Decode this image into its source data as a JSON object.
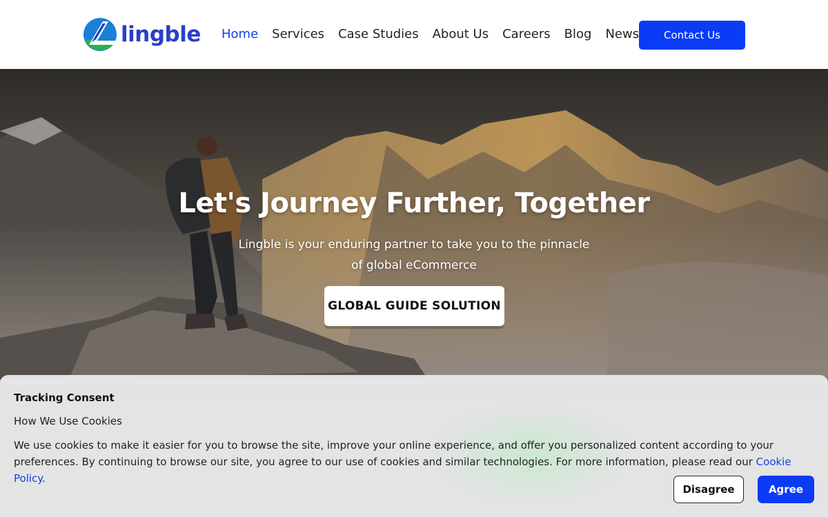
{
  "brand": {
    "name": "lingble",
    "logo_icon": "lingble-logo-icon"
  },
  "nav": {
    "items": [
      {
        "label": "Home",
        "active": true
      },
      {
        "label": "Services"
      },
      {
        "label": "Case Studies"
      },
      {
        "label": "About Us"
      },
      {
        "label": "Careers"
      },
      {
        "label": "Blog"
      },
      {
        "label": "News"
      }
    ],
    "contact_label": "Contact Us"
  },
  "hero": {
    "title": "Let's Journey Further, Together",
    "subtitle": "Lingble is your enduring partner to take you to the pinnacle of global eCommerce",
    "cta_label": "GLOBAL GUIDE SOLUTION"
  },
  "cookie": {
    "title": "Tracking Consent",
    "subtitle": "How We Use Cookies",
    "text": "We use cookies to make it easier for you to browse the site, improve your online experience, and offer you personalized content according to your preferences. By continuing to browse our site, you agree to our use of cookies and similar technologies. For more information, please read our ",
    "link_label": "Cookie Policy",
    "text_end": ".",
    "disagree_label": "Disagree",
    "agree_label": "Agree"
  },
  "colors": {
    "accent": "#0a3cf5",
    "nav_active": "#1240e0"
  }
}
